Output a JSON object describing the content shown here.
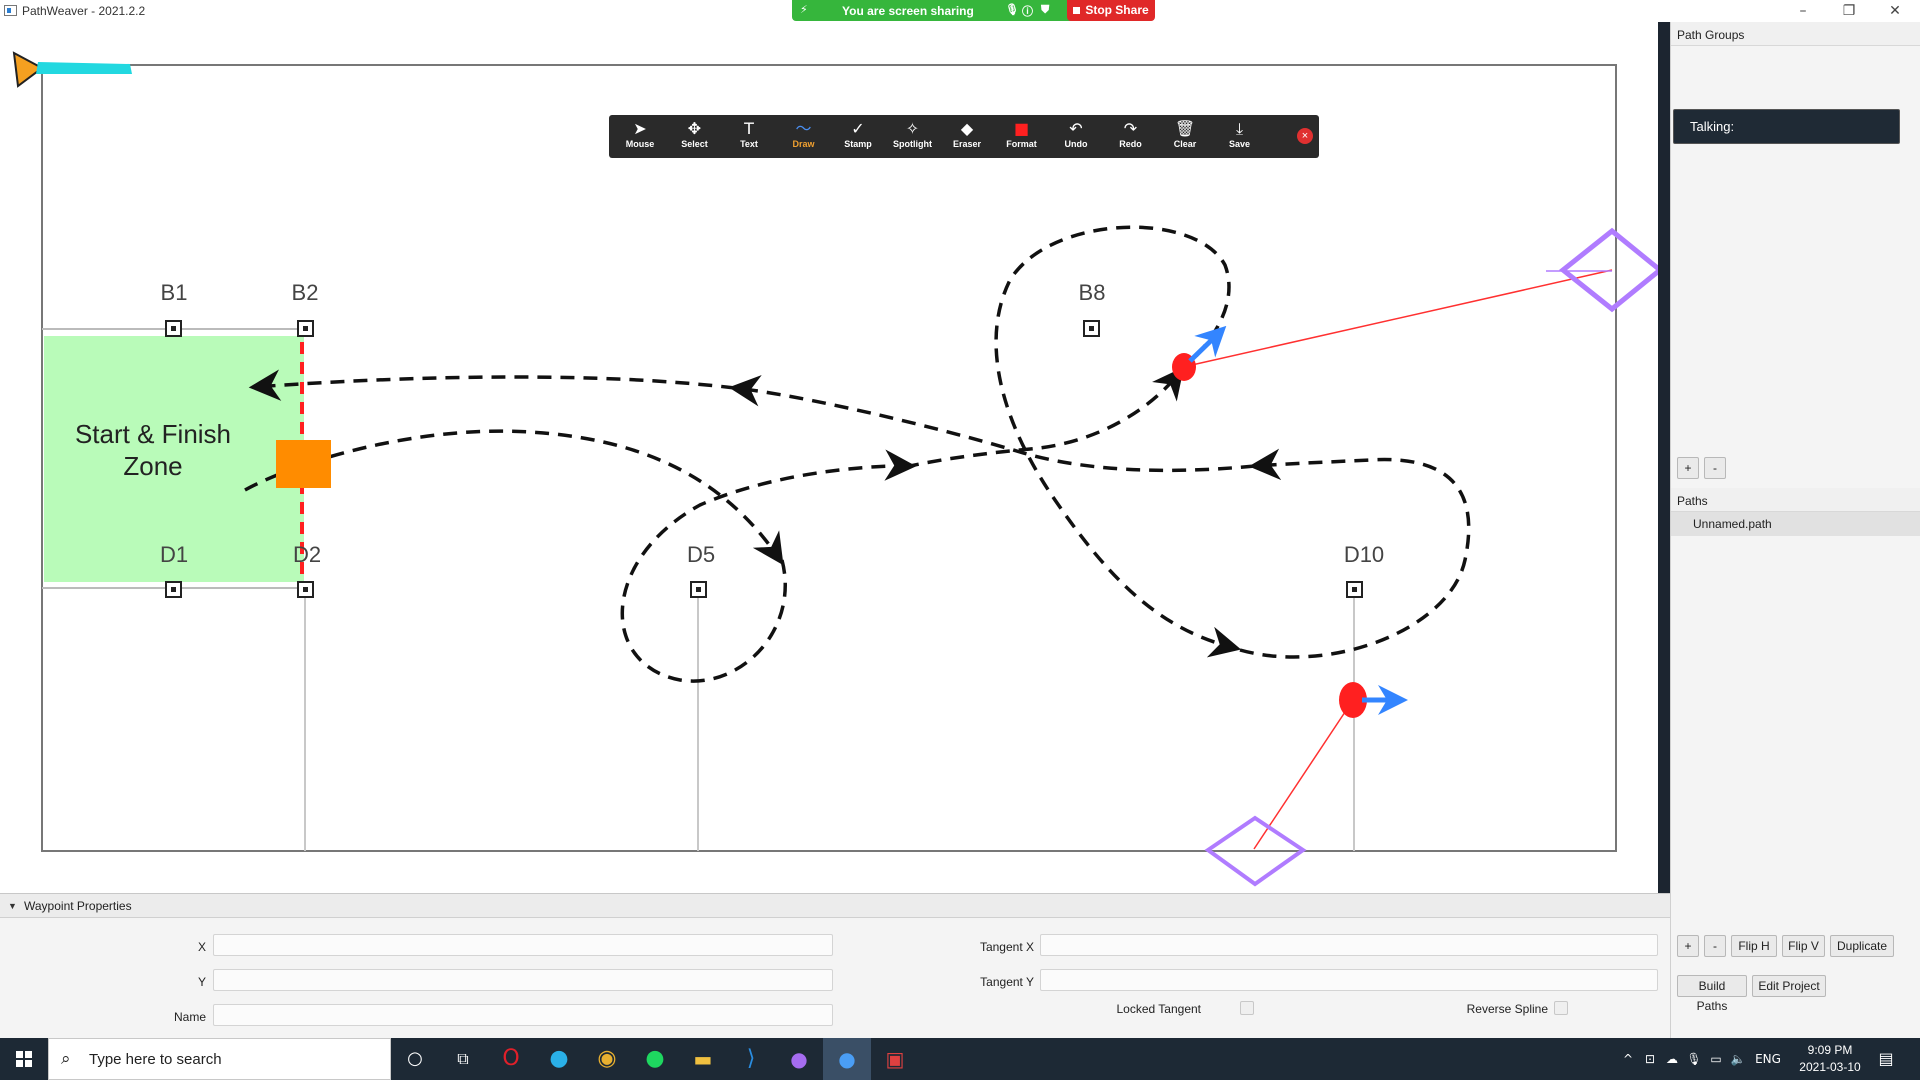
{
  "window": {
    "title": "PathWeaver - 2021.2.2",
    "minimize": "–",
    "restore": "❐",
    "close": "✕"
  },
  "share_banner": {
    "text": "You are screen sharing",
    "stop_label": "Stop Share"
  },
  "annotation_toolbar": {
    "tools": [
      {
        "label": "Mouse",
        "icon": "cursor-icon",
        "glyph": "➤"
      },
      {
        "label": "Select",
        "icon": "move-icon",
        "glyph": "✥"
      },
      {
        "label": "Text",
        "icon": "text-icon",
        "glyph": "T"
      },
      {
        "label": "Draw",
        "icon": "draw-icon",
        "glyph": "〜"
      },
      {
        "label": "Stamp",
        "icon": "stamp-icon",
        "glyph": "✓"
      },
      {
        "label": "Spotlight",
        "icon": "spotlight-icon",
        "glyph": "✧"
      },
      {
        "label": "Eraser",
        "icon": "eraser-icon",
        "glyph": "◆"
      },
      {
        "label": "Format",
        "icon": "format-icon",
        "glyph": "■"
      },
      {
        "label": "Undo",
        "icon": "undo-icon",
        "glyph": "↶"
      },
      {
        "label": "Redo",
        "icon": "redo-icon",
        "glyph": "↷"
      },
      {
        "label": "Clear",
        "icon": "trash-icon",
        "glyph": "🗑"
      },
      {
        "label": "Save",
        "icon": "save-icon",
        "glyph": "⤓"
      }
    ],
    "active_tool": "Draw",
    "close_glyph": "×"
  },
  "field": {
    "markers": {
      "b1": "B1",
      "b2": "B2",
      "b8": "B8",
      "d1": "D1",
      "d2": "D2",
      "d5": "D5",
      "d10": "D10"
    },
    "zone_line1": "Start & Finish",
    "zone_line2": "Zone",
    "zone_color": "#b9fbb9",
    "robot_color": "#ff8c00",
    "waypoint_color": "#ff2020",
    "tangent_color": "#3385ff",
    "handle_color": "#b07cff"
  },
  "right_panel": {
    "path_groups_title": "Path Groups",
    "talking_label": "Talking:",
    "groups_add": "+",
    "groups_remove": "-",
    "paths_title": "Paths",
    "paths": [
      "Unnamed.path"
    ],
    "paths_add": "+",
    "paths_remove": "-",
    "flip_h": "Flip H",
    "flip_v": "Flip V",
    "duplicate": "Duplicate",
    "build_paths": "Build Paths",
    "edit_project": "Edit Project"
  },
  "waypoint_properties": {
    "title": "Waypoint Properties",
    "x_label": "X",
    "y_label": "Y",
    "name_label": "Name",
    "tangent_x_label": "Tangent X",
    "tangent_y_label": "Tangent Y",
    "locked_tangent_label": "Locked Tangent",
    "reverse_spline_label": "Reverse Spline",
    "x_value": "",
    "y_value": "",
    "name_value": "",
    "tangent_x_value": "",
    "tangent_y_value": "",
    "locked_tangent": false,
    "reverse_spline": false
  },
  "taskbar": {
    "search_placeholder": "Type here to search",
    "language": "ENG",
    "time": "9:09 PM",
    "date": "2021-03-10"
  }
}
